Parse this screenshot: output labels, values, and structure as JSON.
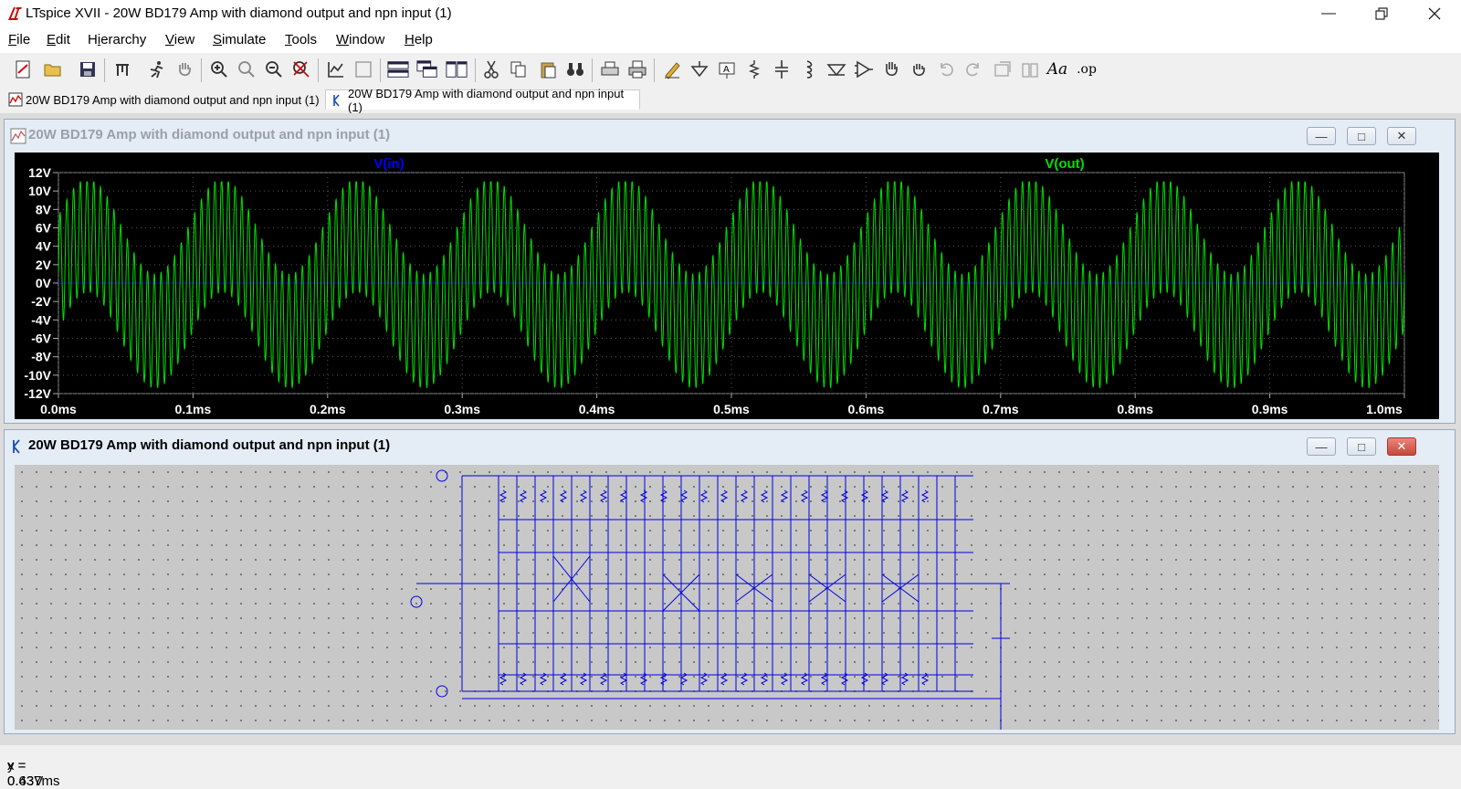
{
  "window": {
    "title": "LTspice XVII - 20W BD179 Amp with diamond output and npn input (1)"
  },
  "menu": [
    "File",
    "Edit",
    "Hierarchy",
    "View",
    "Simulate",
    "Tools",
    "Window",
    "Help"
  ],
  "menu_underline": [
    "F",
    "E",
    "i",
    "V",
    "S",
    "T",
    "W",
    "H"
  ],
  "toolbar": {
    "icons": [
      "new-schematic",
      "open",
      "save",
      "control-panel",
      "run",
      "halt",
      "zoom-in",
      "zoom-pan",
      "zoom-out",
      "zoom-fit",
      "autorange",
      "dc-op-label",
      "tile-horizontal",
      "cascade",
      "tile-vertical",
      "cut",
      "copy",
      "paste",
      "find",
      "print-setup",
      "print",
      "draw-wire",
      "ground",
      "label-net",
      "resistor",
      "capacitor",
      "inductor",
      "diode",
      "component",
      "move",
      "drag",
      "undo",
      "redo",
      "rotate",
      "mirror",
      "text",
      "spice-directive"
    ],
    "spice_label": ".op"
  },
  "tabs": [
    {
      "label": "20W BD179 Amp with diamond output and npn input (1)",
      "icon": "waveform-icon",
      "active": false
    },
    {
      "label": "20W BD179 Amp with diamond output and npn input (1)",
      "icon": "schematic-icon",
      "active": true
    }
  ],
  "plot_window": {
    "title": "20W BD179 Amp with diamond output and npn input (1)"
  },
  "schematic_window": {
    "title": "20W BD179 Amp with diamond output and npn input (1)"
  },
  "status": {
    "x": "x = 0.437ms",
    "y": "y = 0.63V"
  },
  "colors": {
    "vin": "#0000ff",
    "vout": "#00e000",
    "plot_bg": "#000000",
    "grid": "#555555",
    "wire": "#0000e0"
  },
  "chart_data": {
    "type": "line",
    "series": [
      {
        "name": "V(in)",
        "color": "#0000ff",
        "description_values": {
          "amplitude_V": 0.0
        }
      },
      {
        "name": "V(out)",
        "color": "#00e000",
        "carrier_cycles_per_ms": 200,
        "envelope_cycles_per_ms": 10,
        "peak_V": 11,
        "trough_V": -11.5
      }
    ],
    "x_ticks": [
      "0.0ms",
      "0.1ms",
      "0.2ms",
      "0.3ms",
      "0.4ms",
      "0.5ms",
      "0.6ms",
      "0.7ms",
      "0.8ms",
      "0.9ms",
      "1.0ms"
    ],
    "y_ticks": [
      "12V",
      "10V",
      "8V",
      "6V",
      "4V",
      "2V",
      "0V",
      "-2V",
      "-4V",
      "-6V",
      "-8V",
      "-10V",
      "-12V"
    ],
    "xlim_ms": [
      0,
      1.0
    ],
    "ylim_V": [
      -12,
      12
    ],
    "grid": true
  }
}
